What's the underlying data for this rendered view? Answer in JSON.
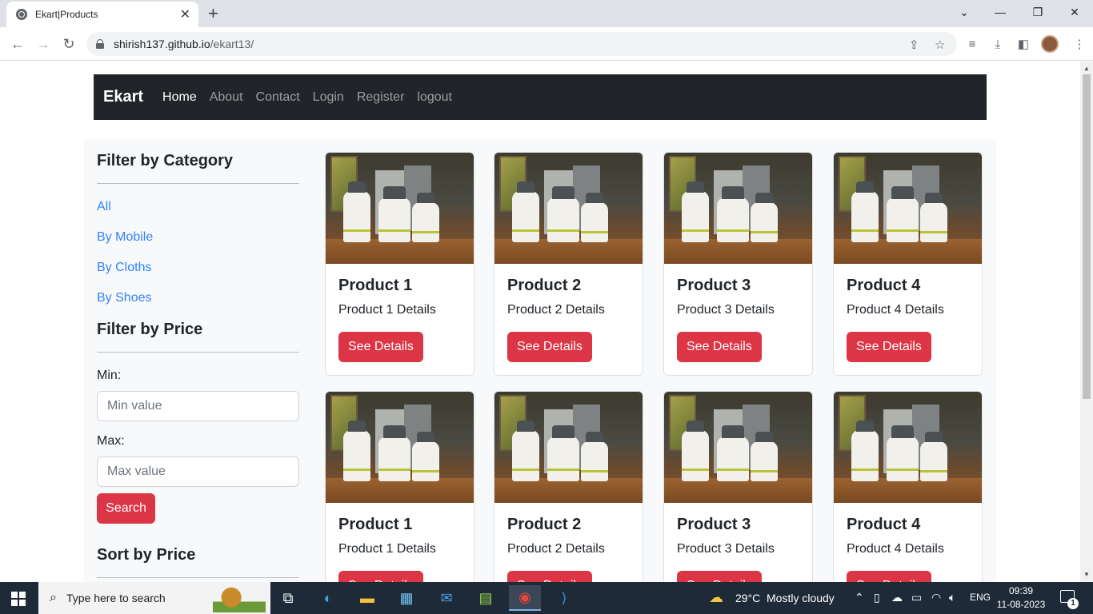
{
  "browser": {
    "tab_title": "Ekart|Products",
    "tab_close": "✕",
    "new_tab": "+",
    "url_host": "shirish137.github.io",
    "url_path": "/ekart13/"
  },
  "navbar": {
    "brand": "Ekart",
    "links": [
      "Home",
      "About",
      "Contact",
      "Login",
      "Register",
      "logout"
    ],
    "active": "Home"
  },
  "sidebar": {
    "category_heading": "Filter by Category",
    "categories": [
      "All",
      "By Mobile",
      "By Cloths",
      "By Shoes"
    ],
    "price_heading": "Filter by Price",
    "min_label": "Min:",
    "min_placeholder": "Min value",
    "max_label": "Max:",
    "max_placeholder": "Max value",
    "search_label": "Search",
    "sort_heading": "Sort by Price"
  },
  "products": [
    {
      "title": "Product 1",
      "details": "Product 1 Details",
      "button": "See Details"
    },
    {
      "title": "Product 2",
      "details": "Product 2 Details",
      "button": "See Details"
    },
    {
      "title": "Product 3",
      "details": "Product 3 Details",
      "button": "See Details"
    },
    {
      "title": "Product 4",
      "details": "Product 4 Details",
      "button": "See Details"
    },
    {
      "title": "Product 1",
      "details": "Product 1 Details",
      "button": "See Details"
    },
    {
      "title": "Product 2",
      "details": "Product 2 Details",
      "button": "See Details"
    },
    {
      "title": "Product 3",
      "details": "Product 3 Details",
      "button": "See Details"
    },
    {
      "title": "Product 4",
      "details": "Product 4 Details",
      "button": "See Details"
    }
  ],
  "taskbar": {
    "search_placeholder": "Type here to search",
    "weather_temp": "29°C",
    "weather_text": "Mostly cloudy",
    "lang": "ENG",
    "time": "09:39",
    "date": "11-08-2023",
    "notification_count": "1"
  },
  "colors": {
    "accent": "#dc3545",
    "navbar": "#212529",
    "link": "#0d6efd"
  }
}
